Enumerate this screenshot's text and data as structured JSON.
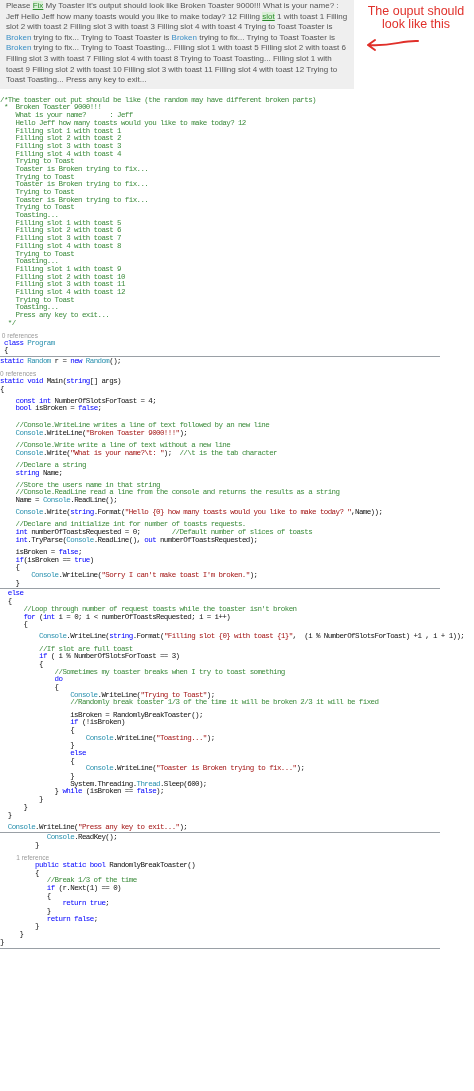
{
  "question": {
    "segments": [
      {
        "kind": "plain",
        "text": "Please "
      },
      {
        "kind": "link",
        "text": "Fix"
      },
      {
        "kind": "plain",
        "text": " My Toaster It's output should look like Broken Toaster 9000!!! What is your name? : Jeff Hello Jeff how many toasts would you like to make today? 12 Filling "
      },
      {
        "kind": "link",
        "text": "slot"
      },
      {
        "kind": "plain",
        "text": " 1 with toast 1 Filling slot 2 with toast 2 Filling slot 3 with toast 3 Filling slot 4 with toast 4 Trying to Toast Toaster is "
      },
      {
        "kind": "term",
        "text": "Broken"
      },
      {
        "kind": "plain",
        "text": " trying to fix... Trying to Toast Toaster is "
      },
      {
        "kind": "term",
        "text": "Broken"
      },
      {
        "kind": "plain",
        "text": " trying to fix... Trying to Toast Toaster is "
      },
      {
        "kind": "term",
        "text": "Broken"
      },
      {
        "kind": "plain",
        "text": " trying to fix... Trying to Toast Toasting... Filling slot 1 with toast 5 Filling slot 2 with toast 6 Filling slot 3 with toast 7 Filling slot 4 with toast 8 Trying to Toast Toasting... Filling slot 1 with toast 9 Filling slot 2 with toast 10 Filling slot 3 with toast 11 Filling slot 4 with toast 12 Trying to Toast Toasting... Press any key to exit..."
      }
    ]
  },
  "annotation": {
    "text": "The ouput should look like this"
  },
  "code": {
    "lines": [
      {
        "kind": "comment",
        "text": "/*The toaster out put should be like (the random may have different broken parts)"
      },
      {
        "kind": "comment",
        "text": " *  Broken Toaster 9000!!!"
      },
      {
        "kind": "comment",
        "text": "    What is your name?      : Jeff"
      },
      {
        "kind": "comment",
        "text": "    Hello Jeff how many toasts would you like to make today? 12"
      },
      {
        "kind": "comment",
        "text": "    Filling slot 1 with toast 1"
      },
      {
        "kind": "comment",
        "text": "    Filling slot 2 with toast 2"
      },
      {
        "kind": "comment",
        "text": "    Filling slot 3 with toast 3"
      },
      {
        "kind": "comment",
        "text": "    Filling slot 4 with toast 4"
      },
      {
        "kind": "comment",
        "text": "    Trying to Toast"
      },
      {
        "kind": "comment",
        "text": "    Toaster is Broken trying to fix..."
      },
      {
        "kind": "comment",
        "text": "    Trying to Toast"
      },
      {
        "kind": "comment",
        "text": "    Toaster is Broken trying to fix..."
      },
      {
        "kind": "comment",
        "text": "    Trying to Toast"
      },
      {
        "kind": "comment",
        "text": "    Toaster is Broken trying to fix..."
      },
      {
        "kind": "comment",
        "text": "    Trying to Toast"
      },
      {
        "kind": "comment",
        "text": "    Toasting..."
      },
      {
        "kind": "comment",
        "text": "    Filling slot 1 with toast 5"
      },
      {
        "kind": "comment",
        "text": "    Filling slot 2 with toast 6"
      },
      {
        "kind": "comment",
        "text": "    Filling slot 3 with toast 7"
      },
      {
        "kind": "comment",
        "text": "    Filling slot 4 with toast 8"
      },
      {
        "kind": "comment",
        "text": "    Trying to Toast"
      },
      {
        "kind": "comment",
        "text": "    Toasting..."
      },
      {
        "kind": "comment",
        "text": "    Filling slot 1 with toast 9"
      },
      {
        "kind": "comment",
        "text": "    Filling slot 2 with toast 10"
      },
      {
        "kind": "comment",
        "text": "    Filling slot 3 with toast 11"
      },
      {
        "kind": "comment",
        "text": "    Filling slot 4 with toast 12"
      },
      {
        "kind": "comment",
        "text": "    Trying to Toast"
      },
      {
        "kind": "comment",
        "text": "    Toasting..."
      },
      {
        "kind": "comment",
        "text": "    Press any key to exit..."
      },
      {
        "kind": "comment",
        "text": "  */"
      },
      {
        "kind": "blank"
      },
      {
        "kind": "lens",
        "text": " 0 references"
      },
      {
        "kind": "code",
        "tokens": [
          {
            "kind": "keyword",
            "text": " class"
          },
          {
            "kind": "type",
            "text": " Program"
          }
        ]
      },
      {
        "kind": "code",
        "tokens": [
          {
            "kind": "plain",
            "text": " {"
          }
        ]
      },
      {
        "kind": "rule"
      },
      {
        "kind": "code",
        "tokens": [
          {
            "kind": "keyword",
            "text": "static"
          },
          {
            "kind": "type",
            "text": " Random"
          },
          {
            "kind": "plain",
            "text": " r = "
          },
          {
            "kind": "keyword",
            "text": "new"
          },
          {
            "kind": "type",
            "text": " Random"
          },
          {
            "kind": "plain",
            "text": "();"
          }
        ]
      },
      {
        "kind": "blank"
      },
      {
        "kind": "lens",
        "text": "0 references"
      },
      {
        "kind": "code",
        "tokens": [
          {
            "kind": "keyword",
            "text": "static void"
          },
          {
            "kind": "plain",
            "text": " Main("
          },
          {
            "kind": "keyword",
            "text": "string"
          },
          {
            "kind": "plain",
            "text": "[] args)"
          }
        ]
      },
      {
        "kind": "code",
        "tokens": [
          {
            "kind": "plain",
            "text": "{"
          }
        ]
      },
      {
        "kind": "blank"
      },
      {
        "kind": "code",
        "tokens": [
          {
            "kind": "keyword",
            "text": "    const int"
          },
          {
            "kind": "plain",
            "text": " NumberOfSlotsForToast = 4;"
          }
        ]
      },
      {
        "kind": "code",
        "tokens": [
          {
            "kind": "keyword",
            "text": "    bool"
          },
          {
            "kind": "plain",
            "text": " isBroken = "
          },
          {
            "kind": "keyword",
            "text": "false"
          },
          {
            "kind": "plain",
            "text": ";"
          }
        ]
      },
      {
        "kind": "blank"
      },
      {
        "kind": "blank"
      },
      {
        "kind": "comment",
        "text": "    //Console.WriteLine writes a line of text followed by an new line"
      },
      {
        "kind": "code",
        "tokens": [
          {
            "kind": "type",
            "text": "    Console"
          },
          {
            "kind": "plain",
            "text": ".WriteLine("
          },
          {
            "kind": "string",
            "text": "\"Broken Toaster 9000!!!\""
          },
          {
            "kind": "plain",
            "text": ");"
          }
        ]
      },
      {
        "kind": "blank"
      },
      {
        "kind": "comment",
        "text": "    //Console.Write write a line of text without a new line"
      },
      {
        "kind": "code",
        "tokens": [
          {
            "kind": "type",
            "text": "    Console"
          },
          {
            "kind": "plain",
            "text": ".Write("
          },
          {
            "kind": "string",
            "text": "\"What is your name?\\t: \""
          },
          {
            "kind": "plain",
            "text": ");  "
          },
          {
            "kind": "comment",
            "text": "//\\t is the tab character"
          }
        ]
      },
      {
        "kind": "blank"
      },
      {
        "kind": "comment",
        "text": "    //Declare a string"
      },
      {
        "kind": "code",
        "tokens": [
          {
            "kind": "keyword",
            "text": "    string"
          },
          {
            "kind": "plain",
            "text": " Name;"
          }
        ]
      },
      {
        "kind": "blank"
      },
      {
        "kind": "comment",
        "text": "    //Store the users name in that string"
      },
      {
        "kind": "comment",
        "text": "    //Console.ReadLine read a line from the console and returns the results as a string"
      },
      {
        "kind": "code",
        "tokens": [
          {
            "kind": "plain",
            "text": "    Name = "
          },
          {
            "kind": "type",
            "text": "Console"
          },
          {
            "kind": "plain",
            "text": ".ReadLine();"
          }
        ]
      },
      {
        "kind": "blank"
      },
      {
        "kind": "code",
        "tokens": [
          {
            "kind": "type",
            "text": "    Console"
          },
          {
            "kind": "plain",
            "text": ".Write("
          },
          {
            "kind": "keyword",
            "text": "string"
          },
          {
            "kind": "plain",
            "text": ".Format("
          },
          {
            "kind": "string",
            "text": "\"Hello {0} how many toasts would you like to make today? \""
          },
          {
            "kind": "plain",
            "text": ",Name));"
          }
        ]
      },
      {
        "kind": "blank"
      },
      {
        "kind": "comment",
        "text": "    //Declare and initialize int for number of toasts requests."
      },
      {
        "kind": "code",
        "tokens": [
          {
            "kind": "keyword",
            "text": "    int"
          },
          {
            "kind": "plain",
            "text": " numberOfToastsRequested = 0;        "
          },
          {
            "kind": "comment",
            "text": "//Default number of slices of toasts"
          }
        ]
      },
      {
        "kind": "code",
        "tokens": [
          {
            "kind": "keyword",
            "text": "    int"
          },
          {
            "kind": "plain",
            "text": ".TryParse("
          },
          {
            "kind": "type",
            "text": "Console"
          },
          {
            "kind": "plain",
            "text": ".ReadLine(), "
          },
          {
            "kind": "keyword",
            "text": "out"
          },
          {
            "kind": "plain",
            "text": " numberOfToastsRequested);"
          }
        ]
      },
      {
        "kind": "blank"
      },
      {
        "kind": "code",
        "tokens": [
          {
            "kind": "plain",
            "text": "    isBroken = "
          },
          {
            "kind": "keyword",
            "text": "false"
          },
          {
            "kind": "plain",
            "text": ";"
          }
        ]
      },
      {
        "kind": "code",
        "tokens": [
          {
            "kind": "keyword",
            "text": "    if"
          },
          {
            "kind": "plain",
            "text": "(isBroken == "
          },
          {
            "kind": "keyword",
            "text": "true"
          },
          {
            "kind": "plain",
            "text": ")"
          }
        ]
      },
      {
        "kind": "code",
        "tokens": [
          {
            "kind": "plain",
            "text": "    {"
          }
        ]
      },
      {
        "kind": "code",
        "tokens": [
          {
            "kind": "type",
            "text": "        Console"
          },
          {
            "kind": "plain",
            "text": ".WriteLine("
          },
          {
            "kind": "string",
            "text": "\"Sorry I can't make toast I'm broken.\""
          },
          {
            "kind": "plain",
            "text": ");"
          }
        ]
      },
      {
        "kind": "code",
        "tokens": [
          {
            "kind": "plain",
            "text": "    }"
          }
        ]
      },
      {
        "kind": "rule"
      },
      {
        "kind": "code",
        "tokens": [
          {
            "kind": "keyword",
            "text": "  else"
          }
        ]
      },
      {
        "kind": "code",
        "tokens": [
          {
            "kind": "plain",
            "text": "  {"
          }
        ]
      },
      {
        "kind": "comment",
        "text": "      //Loop through number of request toasts while the toaster isn't broken"
      },
      {
        "kind": "code",
        "tokens": [
          {
            "kind": "keyword",
            "text": "      for"
          },
          {
            "kind": "plain",
            "text": " ("
          },
          {
            "kind": "keyword",
            "text": "int"
          },
          {
            "kind": "plain",
            "text": " i = 0; i < numberOfToastsRequested; i = i++)"
          }
        ]
      },
      {
        "kind": "code",
        "tokens": [
          {
            "kind": "plain",
            "text": "      {"
          }
        ]
      },
      {
        "kind": "blank"
      },
      {
        "kind": "code",
        "tokens": [
          {
            "kind": "type",
            "text": "          Console"
          },
          {
            "kind": "plain",
            "text": ".WriteLine("
          },
          {
            "kind": "keyword",
            "text": "string"
          },
          {
            "kind": "plain",
            "text": ".Format("
          },
          {
            "kind": "string",
            "text": "\"Filling slot {0} with toast {1}\""
          },
          {
            "kind": "plain",
            "text": ",  (i % NumberOfSlotsForToast) +1 , i + 1));"
          }
        ]
      },
      {
        "kind": "blank"
      },
      {
        "kind": "comment",
        "text": "          //If slot are full toast"
      },
      {
        "kind": "code",
        "tokens": [
          {
            "kind": "keyword",
            "text": "          if"
          },
          {
            "kind": "plain",
            "text": " ( i % NumberOfSlotsForToast == 3)"
          }
        ]
      },
      {
        "kind": "code",
        "tokens": [
          {
            "kind": "plain",
            "text": "          {"
          }
        ]
      },
      {
        "kind": "comment",
        "text": "              //Sometimes my toaster breaks when I try to toast something"
      },
      {
        "kind": "code",
        "tokens": [
          {
            "kind": "keyword",
            "text": "              do"
          }
        ]
      },
      {
        "kind": "code",
        "tokens": [
          {
            "kind": "plain",
            "text": "              {"
          }
        ]
      },
      {
        "kind": "code",
        "tokens": [
          {
            "kind": "type",
            "text": "                  Console"
          },
          {
            "kind": "plain",
            "text": ".WriteLine("
          },
          {
            "kind": "string",
            "text": "\"Trying to Toast\""
          },
          {
            "kind": "plain",
            "text": ");"
          }
        ]
      },
      {
        "kind": "comment",
        "text": "                  //Randomly break toaster 1/3 of the time it will be broken 2/3 it will be fixed"
      },
      {
        "kind": "blank"
      },
      {
        "kind": "code",
        "tokens": [
          {
            "kind": "plain",
            "text": "                  isBroken = RandomlyBreakToaster();"
          }
        ]
      },
      {
        "kind": "code",
        "tokens": [
          {
            "kind": "keyword",
            "text": "                  if"
          },
          {
            "kind": "plain",
            "text": " (!isBroken)"
          }
        ]
      },
      {
        "kind": "code",
        "tokens": [
          {
            "kind": "plain",
            "text": "                  {"
          }
        ]
      },
      {
        "kind": "code",
        "tokens": [
          {
            "kind": "type",
            "text": "                      Console"
          },
          {
            "kind": "plain",
            "text": ".WriteLine("
          },
          {
            "kind": "string",
            "text": "\"Toasting...\""
          },
          {
            "kind": "plain",
            "text": ");"
          }
        ]
      },
      {
        "kind": "code",
        "tokens": [
          {
            "kind": "plain",
            "text": "                  }"
          }
        ]
      },
      {
        "kind": "code",
        "tokens": [
          {
            "kind": "keyword",
            "text": "                  else"
          }
        ]
      },
      {
        "kind": "code",
        "tokens": [
          {
            "kind": "plain",
            "text": "                  {"
          }
        ]
      },
      {
        "kind": "code",
        "tokens": [
          {
            "kind": "type",
            "text": "                      Console"
          },
          {
            "kind": "plain",
            "text": ".WriteLine("
          },
          {
            "kind": "string",
            "text": "\"Toaster is Broken trying to fix...\""
          },
          {
            "kind": "plain",
            "text": ");"
          }
        ]
      },
      {
        "kind": "code",
        "tokens": [
          {
            "kind": "plain",
            "text": "                  }"
          }
        ]
      },
      {
        "kind": "code",
        "tokens": [
          {
            "kind": "plain",
            "text": "                  System.Threading."
          },
          {
            "kind": "type",
            "text": "Thread"
          },
          {
            "kind": "plain",
            "text": ".Sleep(600);"
          }
        ]
      },
      {
        "kind": "code",
        "tokens": [
          {
            "kind": "plain",
            "text": "              } "
          },
          {
            "kind": "keyword",
            "text": "while"
          },
          {
            "kind": "plain",
            "text": " (isBroken == "
          },
          {
            "kind": "keyword",
            "text": "false"
          },
          {
            "kind": "plain",
            "text": ");"
          }
        ]
      },
      {
        "kind": "code",
        "tokens": [
          {
            "kind": "plain",
            "text": "          }"
          }
        ]
      },
      {
        "kind": "code",
        "tokens": [
          {
            "kind": "plain",
            "text": "      }"
          }
        ]
      },
      {
        "kind": "code",
        "tokens": [
          {
            "kind": "plain",
            "text": "  }"
          }
        ]
      },
      {
        "kind": "blank"
      },
      {
        "kind": "code",
        "tokens": [
          {
            "kind": "type",
            "text": "  Console"
          },
          {
            "kind": "plain",
            "text": ".WriteLine("
          },
          {
            "kind": "string",
            "text": "\"Press any key to exit...\""
          },
          {
            "kind": "plain",
            "text": ");"
          }
        ]
      },
      {
        "kind": "rule"
      },
      {
        "kind": "code",
        "tokens": [
          {
            "kind": "type",
            "text": "            Console"
          },
          {
            "kind": "plain",
            "text": ".ReadKey();"
          }
        ]
      },
      {
        "kind": "code",
        "tokens": [
          {
            "kind": "plain",
            "text": "         }"
          }
        ]
      },
      {
        "kind": "blank"
      },
      {
        "kind": "lens",
        "text": "         1 reference"
      },
      {
        "kind": "code",
        "tokens": [
          {
            "kind": "keyword",
            "text": "         public static bool"
          },
          {
            "kind": "plain",
            "text": " RandomlyBreakToaster()"
          }
        ]
      },
      {
        "kind": "code",
        "tokens": [
          {
            "kind": "plain",
            "text": "         {"
          }
        ]
      },
      {
        "kind": "comment",
        "text": "            //Break 1/3 of the time"
      },
      {
        "kind": "code",
        "tokens": [
          {
            "kind": "keyword",
            "text": "            if"
          },
          {
            "kind": "plain",
            "text": " (r.Next(1) == 0)"
          }
        ]
      },
      {
        "kind": "code",
        "tokens": [
          {
            "kind": "plain",
            "text": "            {"
          }
        ]
      },
      {
        "kind": "code",
        "tokens": [
          {
            "kind": "keyword",
            "text": "                return true"
          },
          {
            "kind": "plain",
            "text": ";"
          }
        ]
      },
      {
        "kind": "code",
        "tokens": [
          {
            "kind": "plain",
            "text": "            }"
          }
        ]
      },
      {
        "kind": "code",
        "tokens": [
          {
            "kind": "keyword",
            "text": "            return false"
          },
          {
            "kind": "plain",
            "text": ";"
          }
        ]
      },
      {
        "kind": "code",
        "tokens": [
          {
            "kind": "plain",
            "text": "         }"
          }
        ]
      },
      {
        "kind": "code",
        "tokens": [
          {
            "kind": "plain",
            "text": "     }"
          }
        ]
      },
      {
        "kind": "code",
        "tokens": [
          {
            "kind": "plain",
            "text": "}"
          }
        ]
      },
      {
        "kind": "rule"
      }
    ]
  }
}
